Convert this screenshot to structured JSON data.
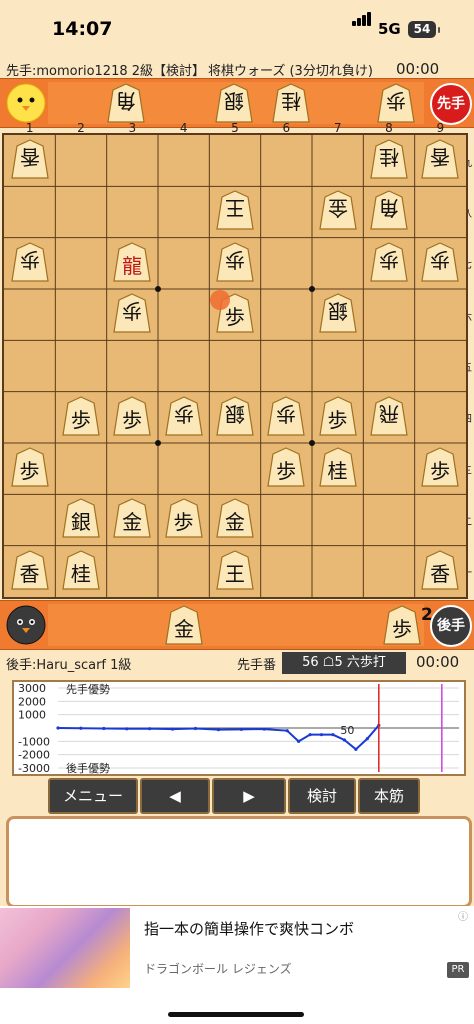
{
  "status": {
    "time": "14:07",
    "network": "5G",
    "battery": "54"
  },
  "header": {
    "sente_player": "先手:momorio1218 2級【検討】",
    "game_type": "将棋ウォーズ (3分切れ負け)",
    "sente_clock": "00:00"
  },
  "gote_hand_badge": "先手",
  "sente_hand_badge": "後手",
  "sente_hand_count": "2",
  "files": [
    "1",
    "2",
    "3",
    "4",
    "5",
    "6",
    "7",
    "8",
    "9"
  ],
  "ranks": [
    "九",
    "八",
    "七",
    "六",
    "五",
    "四",
    "三",
    "二",
    "一"
  ],
  "top_hand": [
    {
      "char": "角",
      "flip": true
    },
    {
      "char": "銀",
      "flip": true
    },
    {
      "char": "桂",
      "flip": true
    },
    {
      "char": "歩",
      "flip": true
    }
  ],
  "bottom_hand": [
    {
      "char": "金",
      "flip": false
    },
    {
      "char": "歩",
      "flip": false
    }
  ],
  "board": [
    {
      "r": 0,
      "c": 0,
      "char": "香",
      "flip": true
    },
    {
      "r": 0,
      "c": 7,
      "char": "桂",
      "flip": true
    },
    {
      "r": 0,
      "c": 8,
      "char": "香",
      "flip": true
    },
    {
      "r": 1,
      "c": 4,
      "char": "王",
      "flip": true
    },
    {
      "r": 1,
      "c": 6,
      "char": "金",
      "flip": true
    },
    {
      "r": 1,
      "c": 7,
      "char": "角",
      "flip": true
    },
    {
      "r": 2,
      "c": 0,
      "char": "歩",
      "flip": true
    },
    {
      "r": 2,
      "c": 2,
      "char": "龍",
      "flip": false,
      "red": true
    },
    {
      "r": 2,
      "c": 4,
      "char": "歩",
      "flip": true
    },
    {
      "r": 2,
      "c": 7,
      "char": "歩",
      "flip": true
    },
    {
      "r": 2,
      "c": 8,
      "char": "歩",
      "flip": true
    },
    {
      "r": 3,
      "c": 2,
      "char": "歩",
      "flip": true
    },
    {
      "r": 3,
      "c": 4,
      "char": "歩",
      "flip": false
    },
    {
      "r": 3,
      "c": 6,
      "char": "銀",
      "flip": true
    },
    {
      "r": 5,
      "c": 1,
      "char": "歩",
      "flip": false
    },
    {
      "r": 5,
      "c": 2,
      "char": "歩",
      "flip": false
    },
    {
      "r": 5,
      "c": 3,
      "char": "歩",
      "flip": true
    },
    {
      "r": 5,
      "c": 4,
      "char": "銀",
      "flip": true
    },
    {
      "r": 5,
      "c": 5,
      "char": "歩",
      "flip": true
    },
    {
      "r": 5,
      "c": 6,
      "char": "歩",
      "flip": false
    },
    {
      "r": 5,
      "c": 7,
      "char": "飛",
      "flip": true
    },
    {
      "r": 6,
      "c": 0,
      "char": "歩",
      "flip": false
    },
    {
      "r": 6,
      "c": 5,
      "char": "歩",
      "flip": false
    },
    {
      "r": 6,
      "c": 6,
      "char": "桂",
      "flip": false
    },
    {
      "r": 6,
      "c": 8,
      "char": "歩",
      "flip": false
    },
    {
      "r": 7,
      "c": 1,
      "char": "銀",
      "flip": false
    },
    {
      "r": 7,
      "c": 2,
      "char": "金",
      "flip": false
    },
    {
      "r": 7,
      "c": 3,
      "char": "歩",
      "flip": false
    },
    {
      "r": 7,
      "c": 4,
      "char": "金",
      "flip": false
    },
    {
      "r": 8,
      "c": 0,
      "char": "香",
      "flip": false
    },
    {
      "r": 8,
      "c": 1,
      "char": "桂",
      "flip": false
    },
    {
      "r": 8,
      "c": 4,
      "char": "王",
      "flip": false
    },
    {
      "r": 8,
      "c": 8,
      "char": "香",
      "flip": false
    }
  ],
  "gote": {
    "player": "後手:Haru_scarf 1級",
    "clock": "00:00"
  },
  "turn_label": "先手番",
  "last_move": "56 ☖5 六歩打",
  "chart_data": {
    "type": "line",
    "ylim": [
      -3000,
      3000
    ],
    "yticks": [
      "3000",
      "2000",
      "1000",
      "-1000",
      "-2000",
      "-3000"
    ],
    "label_top": "先手優勢",
    "label_bottom": "後手優勢",
    "annotation": "50",
    "x": [
      0,
      4,
      8,
      12,
      16,
      20,
      24,
      28,
      32,
      36,
      40,
      42,
      44,
      46,
      48,
      50,
      52,
      54,
      56
    ],
    "values": [
      0,
      -20,
      -40,
      -60,
      -50,
      -80,
      -40,
      -120,
      -100,
      -80,
      -200,
      -1000,
      -500,
      -500,
      -500,
      -900,
      -1600,
      -800,
      200
    ],
    "line_color": "#1a3ad6",
    "cursor_color": "#e02020",
    "end_color": "#d040e0"
  },
  "buttons": [
    {
      "label": "メニュー",
      "name": "menu-button"
    },
    {
      "label": "◀",
      "name": "prev-move-button"
    },
    {
      "label": "▶",
      "name": "next-move-button"
    },
    {
      "label": "検討",
      "name": "analyze-button"
    },
    {
      "label": "本筋",
      "name": "mainline-button"
    }
  ],
  "ad": {
    "title": "指一本の簡単操作で爽快コンボ",
    "subtitle": "ドラゴンボール レジェンズ",
    "pr": "PR"
  }
}
